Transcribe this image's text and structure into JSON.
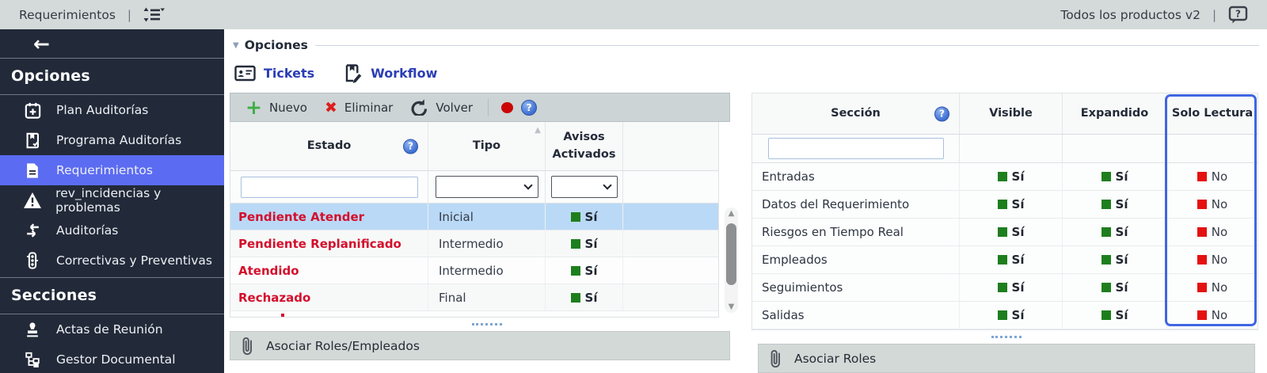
{
  "topbar": {
    "title": "Requerimientos",
    "divider": "|",
    "right_label": "Todos los productos v2"
  },
  "sidebar": {
    "back_arrow": "←",
    "groups": [
      {
        "heading": "Opciones",
        "items": [
          {
            "label": "Plan Auditorías",
            "icon": "calendar-plus-icon",
            "selected": false
          },
          {
            "label": "Programa Auditorías",
            "icon": "book-check-icon",
            "selected": false
          },
          {
            "label": "Requerimientos",
            "icon": "document-icon",
            "selected": true
          },
          {
            "label": "rev_incidencias y problemas",
            "icon": "warning-icon",
            "selected": false
          },
          {
            "label": "Auditorías",
            "icon": "swap-arrows-icon",
            "selected": false
          },
          {
            "label": "Correctivas y Preventivas",
            "icon": "traffic-light-icon",
            "selected": false
          }
        ]
      },
      {
        "heading": "Secciones",
        "items": [
          {
            "label": "Actas de Reunión",
            "icon": "stamp-icon",
            "selected": false
          },
          {
            "label": "Gestor Documental",
            "icon": "org-tree-icon",
            "selected": false
          }
        ]
      }
    ]
  },
  "main": {
    "fieldset_label": "Opciones",
    "collapse_caret": "▼",
    "tabs": [
      {
        "label": "Tickets"
      },
      {
        "label": "Workflow"
      }
    ],
    "toolbar": {
      "new_label": "Nuevo",
      "delete_label": "Eliminar",
      "back_label": "Volver",
      "help_glyph": "?"
    },
    "estado_table": {
      "headers": {
        "estado": "Estado",
        "tipo": "Tipo",
        "avisos": "Avisos Activados"
      },
      "sort_caret": "▲",
      "rows": [
        {
          "estado": "Pendiente Atender",
          "tipo": "Inicial",
          "avisos": "Sí",
          "selected": true
        },
        {
          "estado": "Pendiente Replanificado",
          "tipo": "Intermedio",
          "avisos": "Sí",
          "selected": false
        },
        {
          "estado": "Atendido",
          "tipo": "Intermedio",
          "avisos": "Sí",
          "selected": false
        },
        {
          "estado": "Rechazado",
          "tipo": "Final",
          "avisos": "Sí",
          "selected": false
        }
      ],
      "footer": "Asociar Roles/Empleados"
    },
    "seccion_table": {
      "headers": {
        "seccion": "Sección",
        "visible": "Visible",
        "expandido": "Expandido",
        "solo_lectura": "Solo Lectura"
      },
      "rows": [
        {
          "seccion": "Entradas",
          "visible": "Sí",
          "expandido": "Sí",
          "solo_lectura": "No"
        },
        {
          "seccion": "Datos del Requerimiento",
          "visible": "Sí",
          "expandido": "Sí",
          "solo_lectura": "No"
        },
        {
          "seccion": "Riesgos en Tiempo Real",
          "visible": "Sí",
          "expandido": "Sí",
          "solo_lectura": "No"
        },
        {
          "seccion": "Empleados",
          "visible": "Sí",
          "expandido": "Sí",
          "solo_lectura": "No"
        },
        {
          "seccion": "Seguimientos",
          "visible": "Sí",
          "expandido": "Sí",
          "solo_lectura": "No"
        },
        {
          "seccion": "Salidas",
          "visible": "Sí",
          "expandido": "Sí",
          "solo_lectura": "No"
        }
      ],
      "footer": "Asociar Roles"
    },
    "scroll_up_glyph": "▲",
    "scroll_down_glyph": "▼"
  },
  "colors": {
    "accent_box_blue": "#3f66e3",
    "selected_row_blue": "#bad9f6",
    "sidebar_selected_blue": "#5c6cf2",
    "yes_green": "#1e7e1e",
    "no_red": "#e41111",
    "estado_red": "#d40f2c",
    "tab_link_blue": "#2b3eb5",
    "topbar_gray": "#d4dad9",
    "sidebar_navy": "#222a39"
  }
}
